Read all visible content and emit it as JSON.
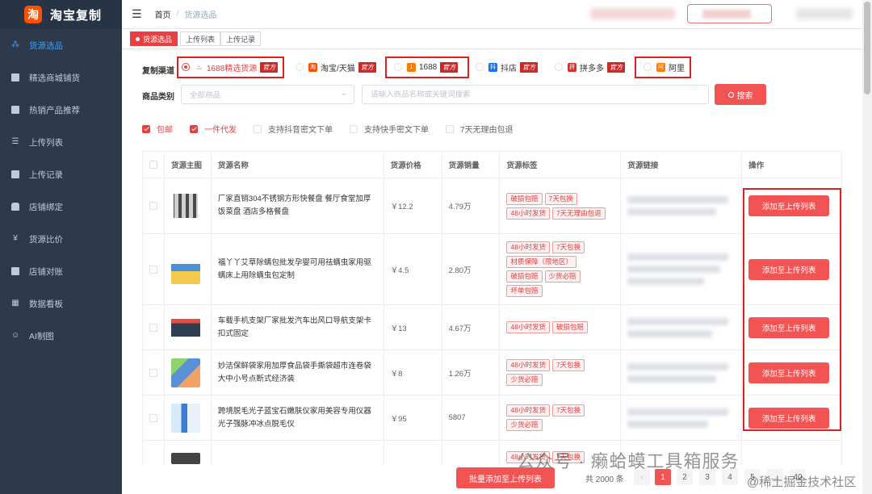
{
  "app": {
    "logo_char": "淘",
    "title": "淘宝复制"
  },
  "sidebar": {
    "items": [
      {
        "label": "货源选品",
        "icon": "sitemap-icon",
        "active": true
      },
      {
        "label": "精选商城铺货",
        "icon": "clipboard-icon"
      },
      {
        "label": "热销产品推荐",
        "icon": "clipboard-icon"
      },
      {
        "label": "上传列表",
        "icon": "list-icon"
      },
      {
        "label": "上传记录",
        "icon": "clipboard-icon"
      },
      {
        "label": "店铺绑定",
        "icon": "lock-icon"
      },
      {
        "label": "货源比价",
        "icon": "yen-icon"
      },
      {
        "label": "店铺对账",
        "icon": "book-icon"
      },
      {
        "label": "数据看板",
        "icon": "grid-icon"
      },
      {
        "label": "AI制图",
        "icon": "robot-icon"
      }
    ]
  },
  "header": {
    "breadcrumb_home": "首页",
    "breadcrumb_sep": "/",
    "breadcrumb_current": "货源选品"
  },
  "tabs": [
    {
      "label": "货源选品",
      "active": true
    },
    {
      "label": "上传列表"
    },
    {
      "label": "上传记录"
    }
  ],
  "filters": {
    "channel_label": "复制渠道",
    "official": "官方",
    "channels": [
      {
        "label": "1688精选货源",
        "checked": true,
        "official": true
      },
      {
        "label": "淘宝/天猫",
        "official": true
      },
      {
        "label": "1688",
        "official": true
      },
      {
        "label": "抖店",
        "official": true
      },
      {
        "label": "拼多多",
        "official": true
      },
      {
        "label": "阿里",
        "official": false
      }
    ],
    "category_label": "商品类别",
    "category_placeholder": "全部商品",
    "search_placeholder": "请输入商品名称或关键词搜索",
    "search_button": "搜索",
    "checkboxes": [
      {
        "label": "包邮",
        "checked": true
      },
      {
        "label": "一件代发",
        "checked": true
      },
      {
        "label": "支持抖音密文下单",
        "checked": false
      },
      {
        "label": "支持快手密文下单",
        "checked": false
      },
      {
        "label": "7天无理由包退",
        "checked": false
      }
    ]
  },
  "table": {
    "headers": [
      "货源主图",
      "货源名称",
      "货源价格",
      "货源销量",
      "货源标签",
      "货源链接",
      "操作"
    ],
    "add_button": "添加至上传列表",
    "rows": [
      {
        "name": "厂家直销304不锈钢方形快餐盘 餐厅食堂加厚饭菜盘 酒店多格餐盘",
        "price": "￥12.2",
        "sales": "4.79万",
        "tags": [
          "破损包赔",
          "7天包换",
          "48小时发货",
          "7天无理由包退"
        ]
      },
      {
        "name": "福丫丫艾草除螨包批发孕婴可用祛螨虫家用驱螨床上用除螨虫包定制",
        "price": "￥4.5",
        "sales": "2.80万",
        "tags": [
          "48小时发货",
          "7天包换",
          "材质保障（限地区）",
          "破损包赔",
          "少货必赔",
          "坏单包赔"
        ]
      },
      {
        "name": "车载手机支架厂家批发汽车出风口导航支架卡扣式固定",
        "price": "￥13",
        "sales": "4.67万",
        "tags": [
          "48小时发货",
          "破损包赔"
        ]
      },
      {
        "name": "妙洁保鲜袋家用加厚食品袋手撕袋超市连卷袋大中小号点断式经济装",
        "price": "￥8",
        "sales": "1.26万",
        "tags": [
          "48小时发货",
          "7天包换",
          "少货必赔"
        ]
      },
      {
        "name": "跨境脱毛光子蓝宝石嫩肤仪家用美容专用仪器光子强脉冲冰点脱毛仪",
        "price": "￥95",
        "sales": "5807",
        "tags": [
          "48小时发货",
          "7天包换",
          "少货必赔"
        ]
      }
    ],
    "partial_row_tags": [
      "48小时发货",
      "7天包换"
    ]
  },
  "footer": {
    "bulk_button": "批量添加至上传列表",
    "total": "共 2000 条",
    "prev": "‹",
    "pages": [
      "1",
      "2",
      "3",
      "4",
      "5"
    ],
    "page_ellipsis": "…",
    "last_page": "40",
    "current_page": "1"
  },
  "watermark": {
    "line1": "公众号 · 癞蛤蟆工具箱服务",
    "line2": "@稀土掘金技术社区"
  },
  "colors": {
    "primary": "#f25454",
    "sidebar_bg": "#2d3a4b",
    "active_menu": "#409eff",
    "official_badge": "#c92a2a"
  }
}
